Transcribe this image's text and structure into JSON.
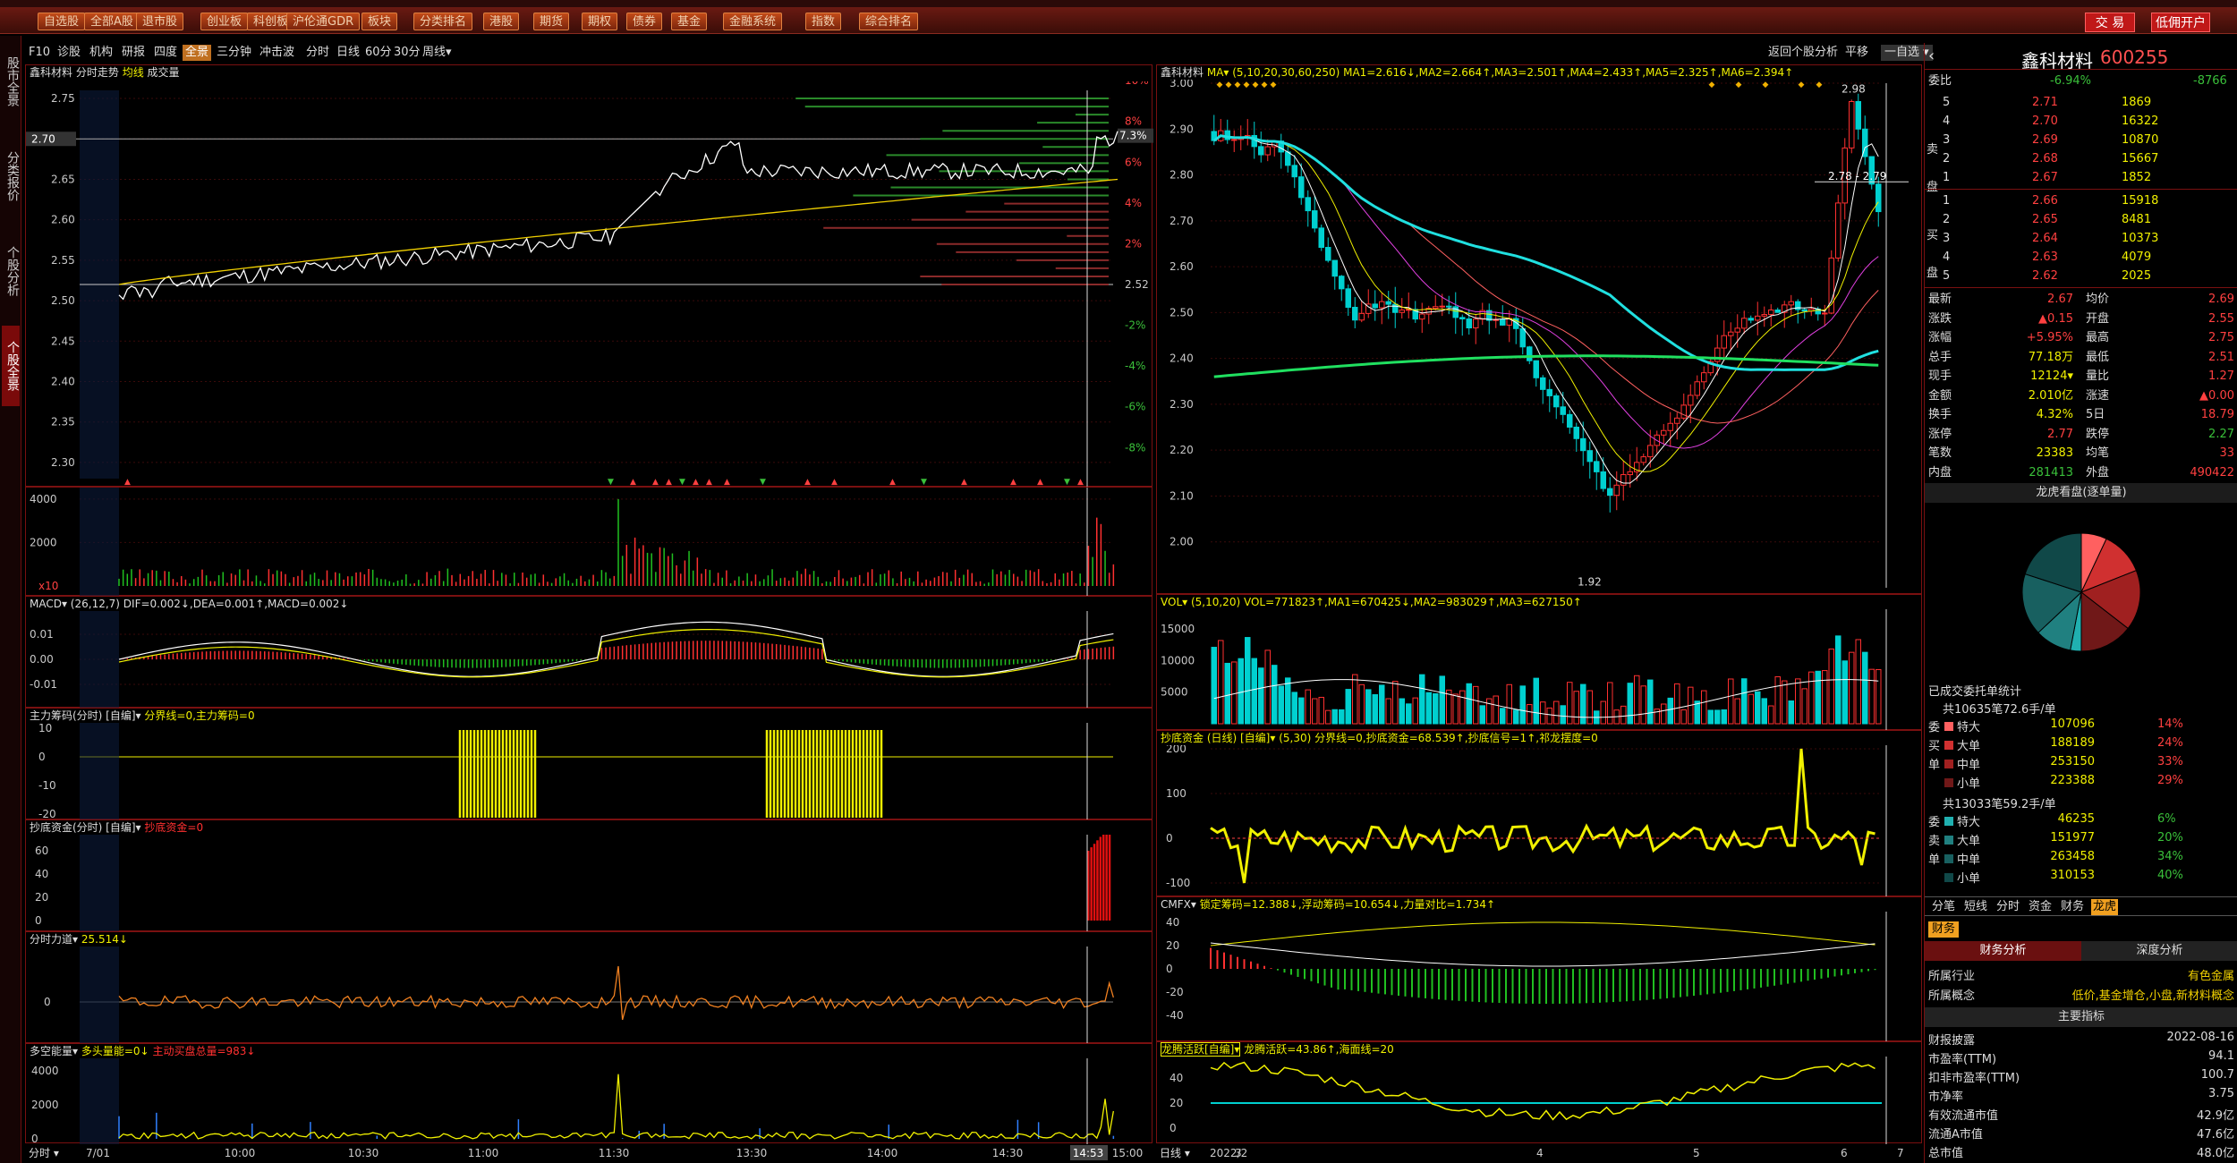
{
  "window": {
    "title": "鑫科材料 - 通达信"
  },
  "topbar": {
    "buttons": [
      "自选股",
      "全部A股",
      "退市股",
      "创业板",
      "科创板",
      "沪伦通GDR",
      "板块",
      "分类排名",
      "港股",
      "期货",
      "期权",
      "债券",
      "基金",
      "金融系统",
      "指数",
      "综合排名"
    ],
    "trade": "交 易",
    "open_account": "低佣开户"
  },
  "toolbar2": {
    "items": [
      "F10",
      "诊股",
      "机构",
      "研报",
      "四度",
      "全景",
      "三分钟",
      "冲击波",
      "分时",
      "日线",
      "60分",
      "30分",
      "周线▾"
    ],
    "active": "全景",
    "right_items": [
      "返回个股分析",
      "平移",
      "一自选 ▾"
    ]
  },
  "leftstrip": {
    "items": [
      "股市全景",
      "分类报价",
      "个股分析",
      "个股全景"
    ],
    "active": "个股全景"
  },
  "intraday": {
    "title": "鑫科材料",
    "sub": "分时走势",
    "avg": "均线",
    "vol": "成交量",
    "price_ticks": [
      "2.75",
      "2.70",
      "2.65",
      "2.60",
      "2.55",
      "2.50",
      "2.45",
      "2.40",
      "2.35",
      "2.30"
    ],
    "pct_ticks": [
      "10%",
      "8%",
      "6%",
      "4%",
      "2%",
      "-2%",
      "-4%",
      "-6%",
      "-8%"
    ],
    "current_marker": "2.70",
    "current_pct": "7.3%",
    "prev_close": "2.52",
    "vol_ticks": [
      "4000",
      "2000"
    ],
    "vol_corner": "x10",
    "time_labels": [
      "7/01",
      "10:00",
      "10:30",
      "11:00",
      "11:30",
      "13:30",
      "14:00",
      "14:30",
      "14:53",
      "15:00"
    ],
    "bottom_left": "分时"
  },
  "macd_i": {
    "title": "MACD▾ (26,12,7) DIF=0.002↓,DEA=0.001↑,MACD=0.002↓",
    "ticks": [
      "0.01",
      "0.00",
      "-0.01"
    ]
  },
  "mainforce": {
    "title": "主力筹码(分时) [自编]▾",
    "sub": "分界线=0,主力筹码=0",
    "ticks": [
      "10",
      "0",
      "-10",
      "-20"
    ]
  },
  "bottomfund_i": {
    "title": "抄底资金(分时) [自编]▾",
    "sub": "抄底资金=0",
    "ticks": [
      "60",
      "40",
      "20",
      "0"
    ]
  },
  "force_i": {
    "title": "分时力道▾",
    "sub": "25.514↓",
    "ticks": [
      "0"
    ]
  },
  "energy": {
    "title": "多空能量▾",
    "sub": "多头量能=0↓",
    "sub2": "主动买盘总量=983↓",
    "ticks": [
      "4000",
      "2000",
      "0"
    ]
  },
  "daily": {
    "title": "鑫科材料",
    "ma": "MA▾ (5,10,20,30,60,250) MA1=2.616↓,MA2=2.664↑,MA3=2.501↑,MA4=2.433↑,MA5=2.325↑,MA6=2.394↑",
    "price_ticks": [
      "3.00",
      "2.90",
      "2.80",
      "2.70",
      "2.60",
      "2.50",
      "2.40",
      "2.30",
      "2.20",
      "2.10",
      "2.00"
    ],
    "high_label": "2.98",
    "low_label": "1.92",
    "range_label": "2.78 - 2.79",
    "bottom_left": "日线",
    "date_labels": [
      "2022/2",
      "3",
      "4",
      "5",
      "6",
      "7"
    ]
  },
  "vol_d": {
    "title": "VOL▾ (5,10,20) VOL=771823↑,MA1=670425↓,MA2=983029↑,MA3=627150↑",
    "ticks": [
      "15000",
      "10000",
      "5000"
    ]
  },
  "bottomfund_d": {
    "title": "抄底资金 (日线) [自编]▾ (5,30) 分界线=0,抄底资金=68.539↑,抄底信号=1↑,祁龙摆度=0",
    "ticks": [
      "200",
      "100",
      "0",
      "-100"
    ]
  },
  "cmfx": {
    "title": "CMFX▾",
    "sub": "锁定筹码=12.388↓,浮动筹码=10.654↓,力量对比=1.734↑",
    "ticks": [
      "40",
      "20",
      "0",
      "-20",
      "-40"
    ]
  },
  "dragon": {
    "title": "龙腾活跃[自编]▾",
    "sub": "龙腾活跃=43.86↑,海面线=20",
    "ticks": [
      "40",
      "20",
      "0"
    ]
  },
  "quote": {
    "name": "鑫科材料",
    "code": "600255",
    "webi": "委比",
    "webi_val": "-6.94%",
    "webi_val2": "-8766",
    "sell": [
      [
        "5",
        "2.71",
        "1869"
      ],
      [
        "4",
        "2.70",
        "16322"
      ],
      [
        "3",
        "2.69",
        "10870"
      ],
      [
        "2",
        "2.68",
        "15667"
      ],
      [
        "1",
        "2.67",
        "1852"
      ]
    ],
    "buy": [
      [
        "1",
        "2.66",
        "15918"
      ],
      [
        "2",
        "2.65",
        "8481"
      ],
      [
        "3",
        "2.64",
        "10373"
      ],
      [
        "4",
        "2.63",
        "4079"
      ],
      [
        "5",
        "2.62",
        "2025"
      ]
    ],
    "stats": [
      [
        "最新",
        "2.67",
        "均价",
        "2.69"
      ],
      [
        "涨跌",
        "▲0.15",
        "开盘",
        "2.55"
      ],
      [
        "涨幅",
        "+5.95%",
        "最高",
        "2.75"
      ],
      [
        "总手",
        "77.18万",
        "最低",
        "2.51"
      ],
      [
        "现手",
        "12124▾",
        "量比",
        "1.27"
      ],
      [
        "金额",
        "2.010亿",
        "涨速",
        "▲0.00"
      ],
      [
        "换手",
        "4.32%",
        "5日",
        "18.79"
      ],
      [
        "涨停",
        "2.77",
        "跌停",
        "2.27"
      ],
      [
        "笔数",
        "23383",
        "均笔",
        "33"
      ],
      [
        "内盘",
        "281413",
        "外盘",
        "490422"
      ]
    ],
    "sell_label": "卖",
    "buy_label": "买",
    "pan_label": "盘"
  },
  "pie": {
    "title": "龙虎看盘(逐单量)"
  },
  "deal": {
    "title": "已成交委托单统计",
    "sum1": "共10635笔72.6手/单",
    "rows1": [
      [
        "特大",
        "107096",
        "14%"
      ],
      [
        "大单",
        "188189",
        "24%"
      ],
      [
        "中单",
        "253150",
        "33%"
      ],
      [
        "小单",
        "223388",
        "29%"
      ]
    ],
    "sum2": "共13033笔59.2手/单",
    "rows2": [
      [
        "特大",
        "46235",
        "6%"
      ],
      [
        "大单",
        "151977",
        "20%"
      ],
      [
        "中单",
        "263458",
        "34%"
      ],
      [
        "小单",
        "310153",
        "40%"
      ]
    ],
    "side1": [
      "委",
      "买",
      "单"
    ],
    "side2": [
      "委",
      "卖",
      "单"
    ]
  },
  "bottomtabs": {
    "items": [
      "分笔",
      "短线",
      "分时",
      "资金",
      "财务",
      "龙虎"
    ],
    "active": "龙虎"
  },
  "finance": {
    "tab": "财务",
    "left": "财务分析",
    "right": "深度分析",
    "industry_l": "所属行业",
    "industry": "有色金属",
    "concept_l": "所属概念",
    "concept": "低价,基金增仓,小盘,新材料概念",
    "main": "主要指标",
    "rows": [
      [
        "财报披露",
        "2022-08-16"
      ],
      [
        "市盈率(TTM)",
        "94.1"
      ],
      [
        "扣非市盈率(TTM)",
        "100.7"
      ],
      [
        "市净率",
        "3.75"
      ],
      [
        "有效流通市值",
        "42.9亿"
      ],
      [
        "流通A市值",
        "47.6亿"
      ],
      [
        "总市值",
        "48.0亿"
      ]
    ]
  },
  "colors": {
    "up": "#ff3030",
    "down": "#00d0d0",
    "yellow": "#f0f000",
    "white": "#ffffff",
    "ma60": "#20e0e0",
    "ma250": "#20e060"
  }
}
